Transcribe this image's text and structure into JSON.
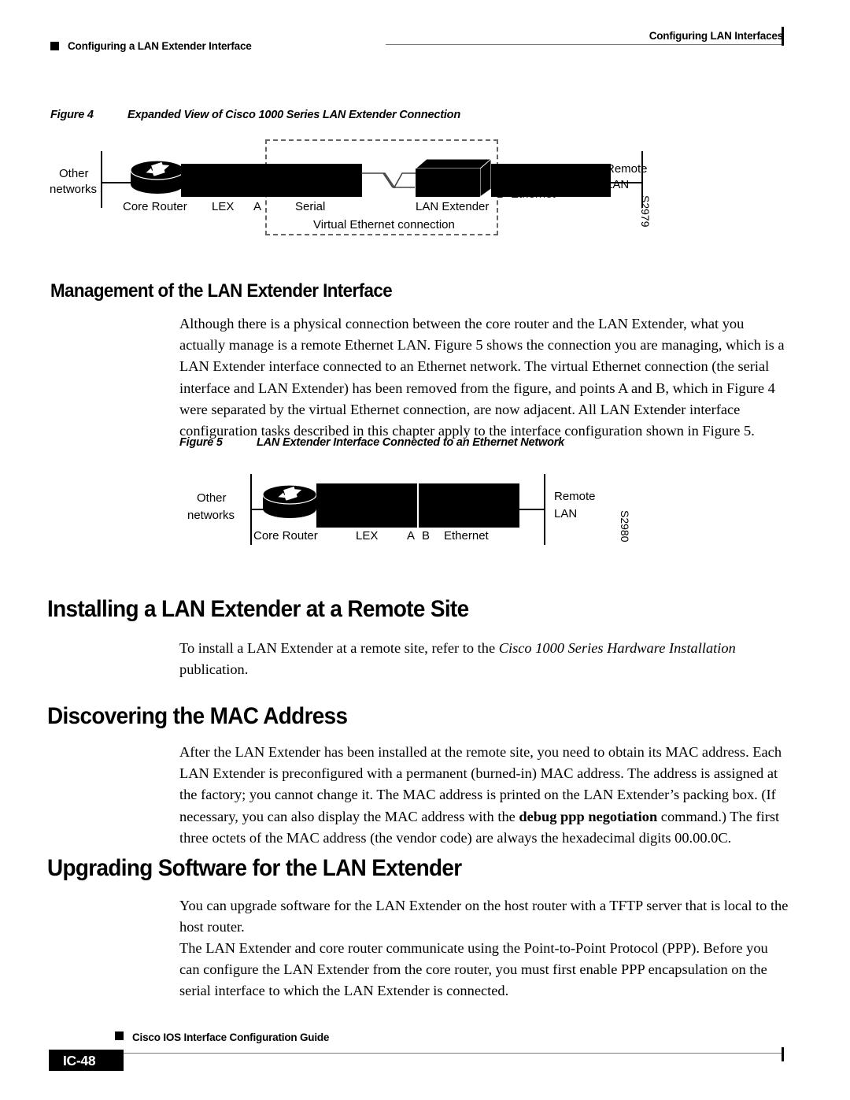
{
  "header": {
    "right_title": "Configuring LAN Interfaces",
    "left_title": "Configuring a LAN Extender Interface"
  },
  "figures": [
    {
      "number": "Figure 4",
      "title": "Expanded View of Cisco 1000 Series LAN Extender Connection",
      "id_code": "S2979",
      "labels": {
        "other": "Other",
        "networks": "networks",
        "core_router": "Core Router",
        "lex": "LEX",
        "point_a": "A",
        "serial": "Serial",
        "lan_extender": "LAN Extender",
        "point_b": "B",
        "ethernet": "Ethernet",
        "remote": "Remote",
        "lan": "LAN",
        "virtual": "Virtual Ethernet connection"
      }
    },
    {
      "number": "Figure 5",
      "title": "LAN Extender Interface Connected to an Ethernet Network",
      "id_code": "S2980",
      "labels": {
        "other": "Other",
        "networks": "networks",
        "core_router": "Core Router",
        "lex": "LEX",
        "point_a": "A",
        "point_b": "B",
        "ethernet": "Ethernet",
        "remote": "Remote",
        "lan": "LAN"
      }
    }
  ],
  "sections": {
    "management": {
      "heading": "Management of the LAN Extender Interface",
      "paragraph": "Although there is a physical connection between the core router and the LAN Extender, what you actually manage is a remote Ethernet LAN. Figure 5 shows the connection you are managing, which is a LAN Extender interface connected to an Ethernet network. The virtual Ethernet connection (the serial interface and LAN Extender) has been removed from the figure, and points A and B, which in Figure 4 were separated by the virtual Ethernet connection, are now adjacent. All LAN Extender interface configuration tasks described in this chapter apply to the interface configuration shown in Figure 5."
    },
    "installing": {
      "heading": "Installing a LAN Extender at a Remote Site",
      "para_before": "To install a LAN Extender at a remote site, refer to the ",
      "para_italic": "Cisco 1000 Series Hardware Installation",
      "para_after": " publication."
    },
    "discovering": {
      "heading": "Discovering the MAC Address",
      "para_before": "After the LAN Extender has been installed at the remote site, you need to obtain its MAC address. Each LAN Extender is preconfigured with a permanent (burned-in) MAC address. The address is assigned at the factory; you cannot change it. The MAC address is printed on the LAN Extender’s packing box. (If necessary, you can also display the MAC address with the ",
      "para_bold": "debug ppp negotiation",
      "para_after": " command.) The first three octets of the MAC address (the vendor code) are always the hexadecimal digits 00.00.0C."
    },
    "upgrading": {
      "heading": "Upgrading Software for the LAN Extender",
      "paragraph_1": "You can upgrade software for the LAN Extender on the host router with a TFTP server that is local to the host router.",
      "paragraph_2": "The LAN Extender and core router communicate using the Point-to-Point Protocol (PPP). Before you can configure the LAN Extender from the core router, you must first enable PPP encapsulation on the serial interface to which the LAN Extender is connected."
    }
  },
  "footer": {
    "guide_title": "Cisco IOS Interface Configuration Guide",
    "page_number": "IC-48"
  }
}
